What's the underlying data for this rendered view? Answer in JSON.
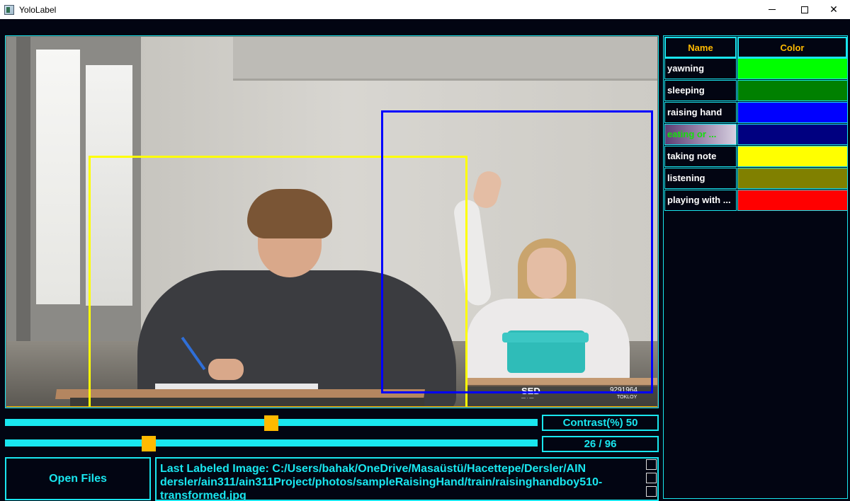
{
  "window": {
    "title": "YoloLabel"
  },
  "table": {
    "header_name": "Name",
    "header_color": "Color",
    "rows": [
      {
        "name": "yawning",
        "color": "#00ff00"
      },
      {
        "name": "sleeping",
        "color": "#008000"
      },
      {
        "name": "raising hand",
        "color": "#0000ff"
      },
      {
        "name": "eating or ...",
        "color": "#000080",
        "selected": true
      },
      {
        "name": "taking note",
        "color": "#ffff00"
      },
      {
        "name": "listening",
        "color": "#808000"
      },
      {
        "name": "playing with ...",
        "color": "#ff0000"
      }
    ]
  },
  "image": {
    "watermark_1": "SED",
    "watermark_2": "9291964",
    "watermark_3": "TOKLOY",
    "watermark_4": "— · —",
    "boxes": [
      {
        "label": "taking note",
        "color": "#ffff00"
      },
      {
        "label": "raising hand",
        "color": "#0000ff"
      }
    ]
  },
  "controls": {
    "contrast_label": "Contrast(%) 50",
    "contrast_value_percent": 50,
    "image_counter": "26 / 96",
    "image_index": 26,
    "image_total": 96,
    "open_files_label": "Open Files",
    "status_text": "Last Labeled Image: C:/Users/bahak/OneDrive/Masaüstü/Hacettepe/Dersler/AIN dersler/ain311/ain311Project/photos/sampleRaisingHand/train/raisinghandboy510-transformed.jpg"
  },
  "colors": {
    "accent": "#19e6ef",
    "handle": "#ffba00",
    "background": "#020512"
  }
}
